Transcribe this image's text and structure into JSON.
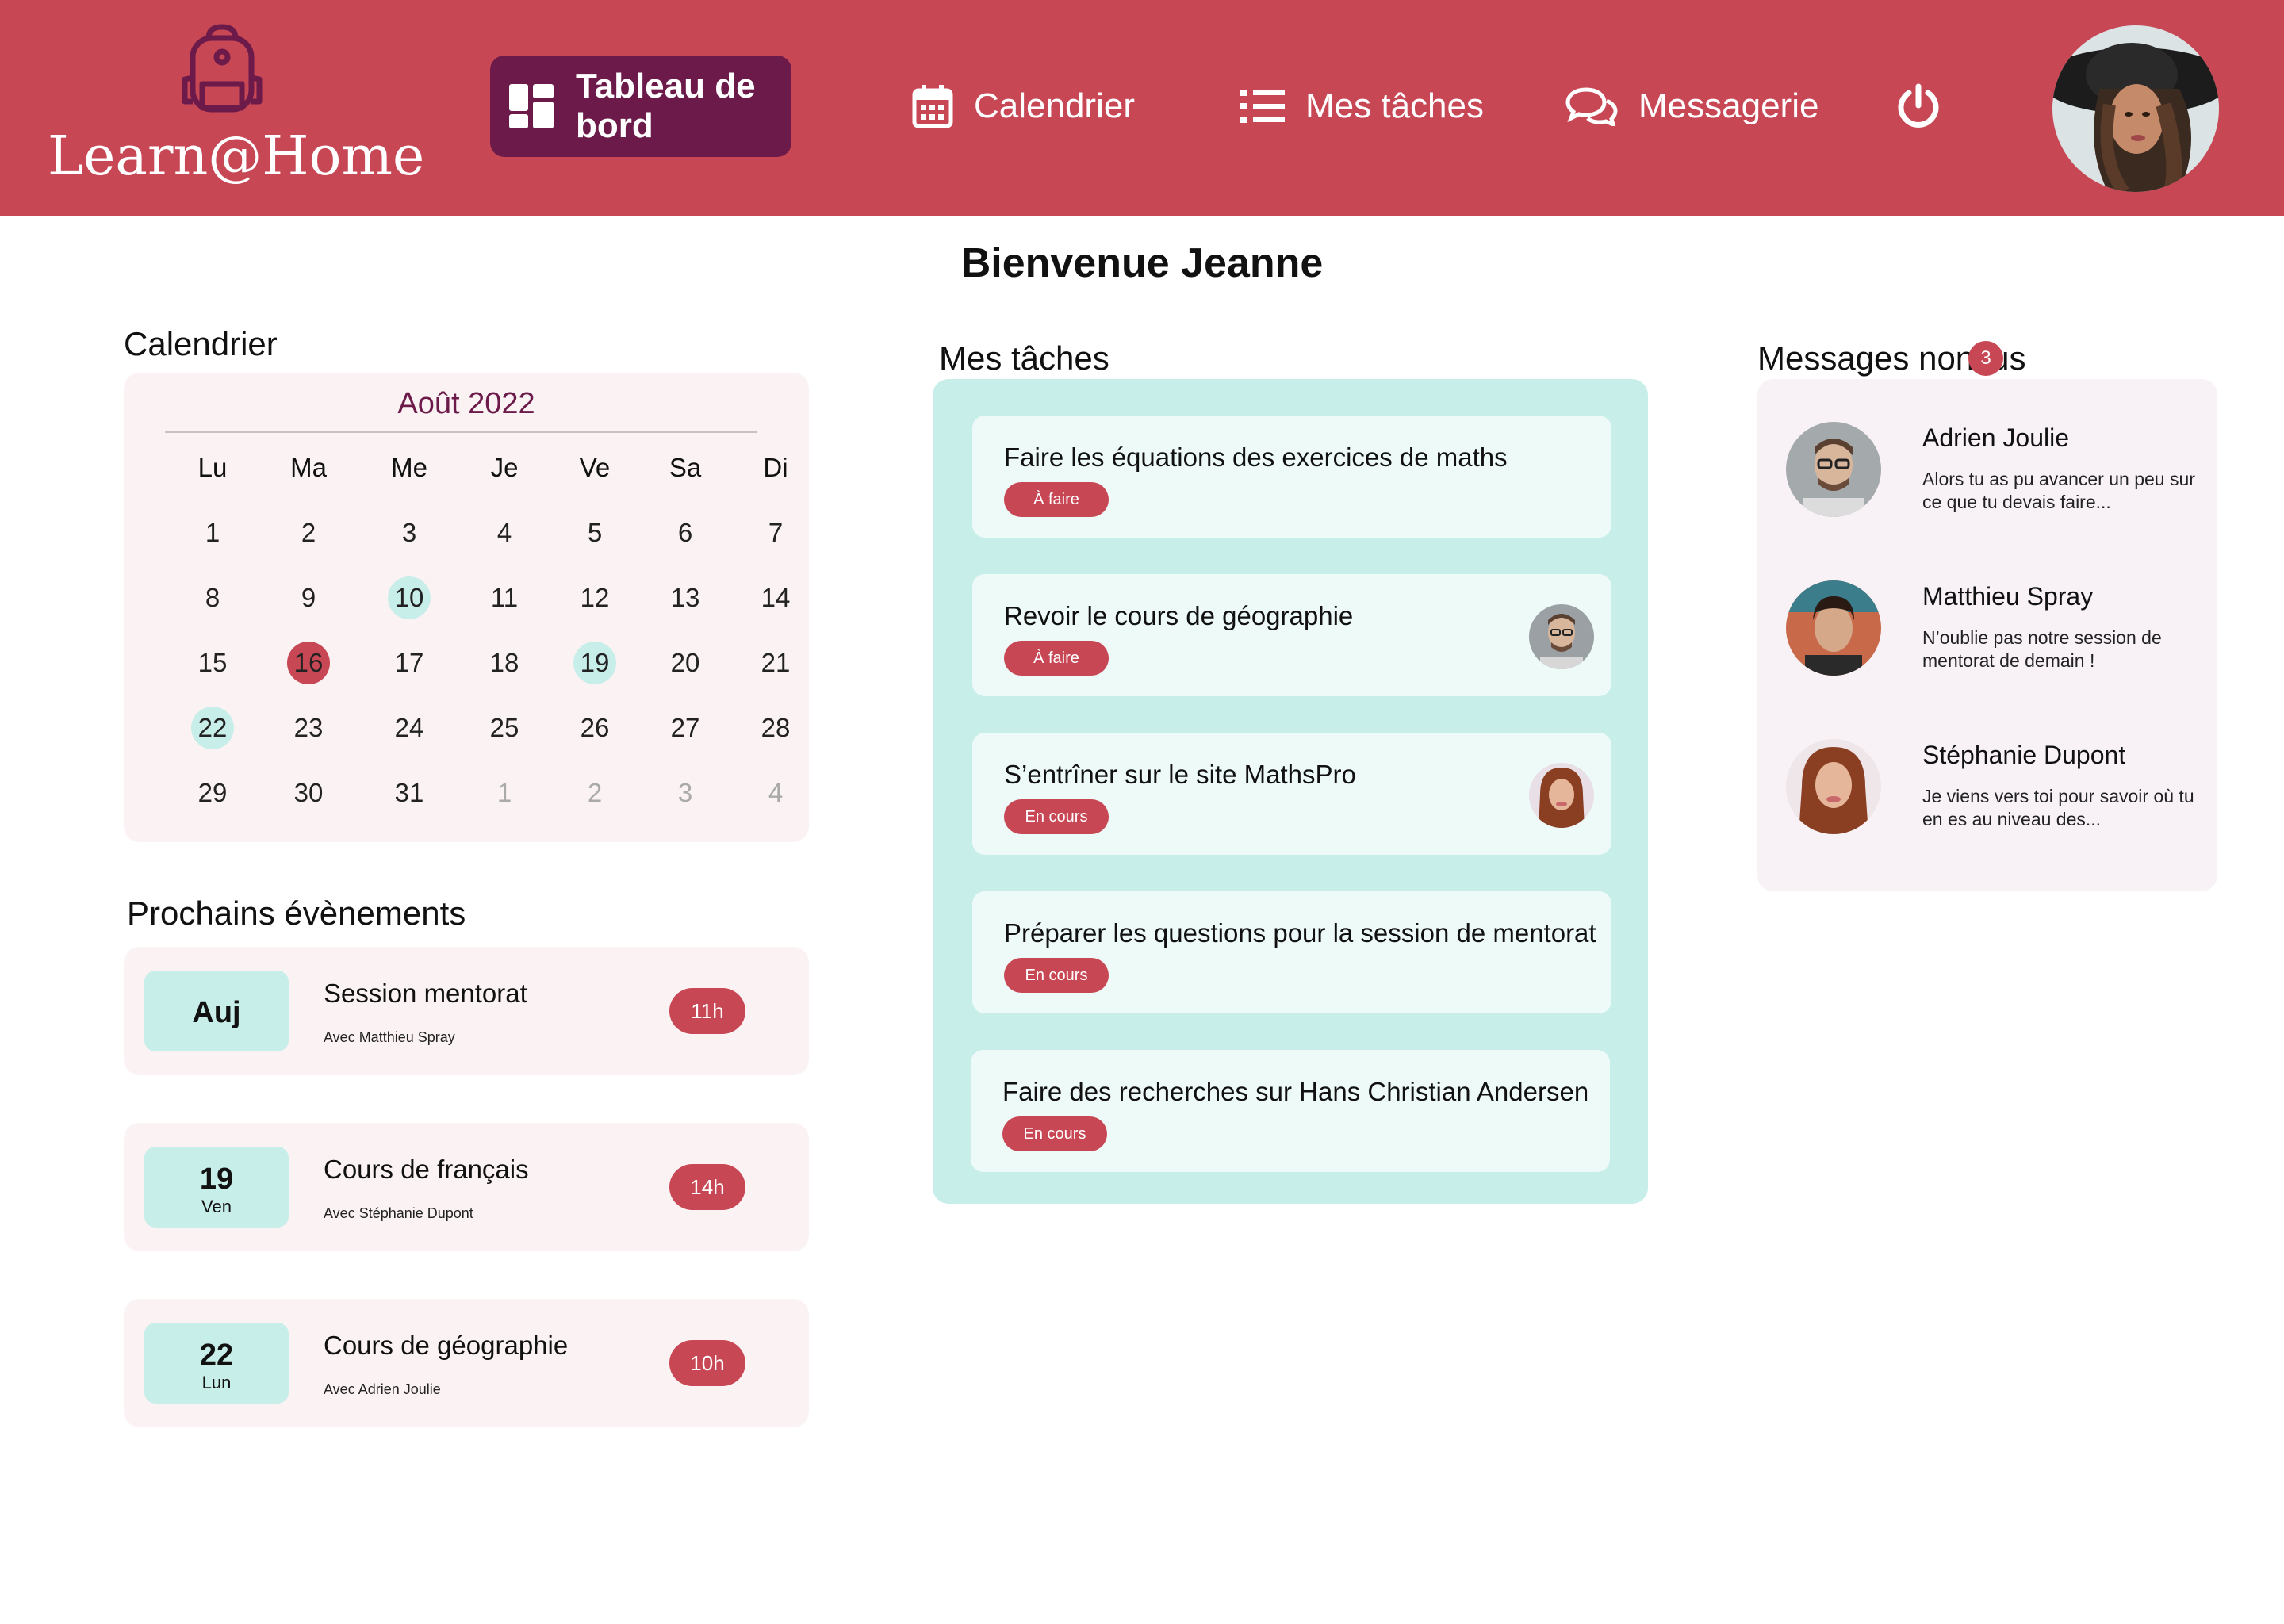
{
  "app": {
    "name": "Learn@Home",
    "logo_icon": "backpack-icon"
  },
  "nav": {
    "items": [
      {
        "label": "Tableau de bord",
        "icon": "dashboard-icon",
        "active": true
      },
      {
        "label": "Calendrier",
        "icon": "calendar-icon",
        "active": false
      },
      {
        "label": "Mes tâches",
        "icon": "list-icon",
        "active": false
      },
      {
        "label": "Messagerie",
        "icon": "chat-bubbles-icon",
        "active": false
      }
    ],
    "power_icon": "power-icon"
  },
  "welcome": "Bienvenue Jeanne",
  "calendar": {
    "title": "Calendrier",
    "month": "Août 2022",
    "weekdays": [
      "Lu",
      "Ma",
      "Me",
      "Je",
      "Ve",
      "Sa",
      "Di"
    ],
    "weeks": [
      [
        "1",
        "2",
        "3",
        "4",
        "5",
        "6",
        "7"
      ],
      [
        "8",
        "9",
        "10",
        "11",
        "12",
        "13",
        "14"
      ],
      [
        "15",
        "16",
        "17",
        "18",
        "19",
        "20",
        "21"
      ],
      [
        "22",
        "23",
        "24",
        "25",
        "26",
        "27",
        "28"
      ],
      [
        "29",
        "30",
        "31",
        "1",
        "2",
        "3",
        "4"
      ]
    ]
  },
  "events": {
    "title": "Prochains évènements",
    "items": [
      {
        "date": "Auj",
        "day": "",
        "title": "Session mentorat",
        "with": "Avec Matthieu Spray",
        "time": "11h"
      },
      {
        "date": "19",
        "day": "Ven",
        "title": "Cours de français",
        "with": "Avec Stéphanie Dupont",
        "time": "14h"
      },
      {
        "date": "22",
        "day": "Lun",
        "title": "Cours de géographie",
        "with": "Avec Adrien Joulie",
        "time": "10h"
      }
    ]
  },
  "tasks": {
    "title": "Mes tâches",
    "items": [
      {
        "title": "Faire les équations des exercices de maths",
        "status": "À faire"
      },
      {
        "title": "Revoir le cours de géographie",
        "status": "À faire"
      },
      {
        "title": "S’entrîner sur le site MathsPro",
        "status": "En cours"
      },
      {
        "title": "Préparer les questions pour la session de mentorat",
        "status": "En cours"
      },
      {
        "title": "Faire des recherches sur Hans Christian Andersen",
        "status": "En cours"
      }
    ]
  },
  "messages": {
    "title": "Messages non lus",
    "count": "3",
    "items": [
      {
        "name": "Adrien Joulie",
        "text": "Alors tu as pu avancer un peu sur ce que tu devais faire..."
      },
      {
        "name": "Matthieu Spray",
        "text": "N’oublie pas notre session de mentorat de demain !"
      },
      {
        "name": "Stéphanie Dupont",
        "text": "Je viens vers toi pour savoir où tu en es au niveau des..."
      }
    ]
  },
  "colors": {
    "primary": "#c84755",
    "dark": "#6b1a4a",
    "mint": "#c8eeea",
    "card": "#fbf3f3"
  }
}
